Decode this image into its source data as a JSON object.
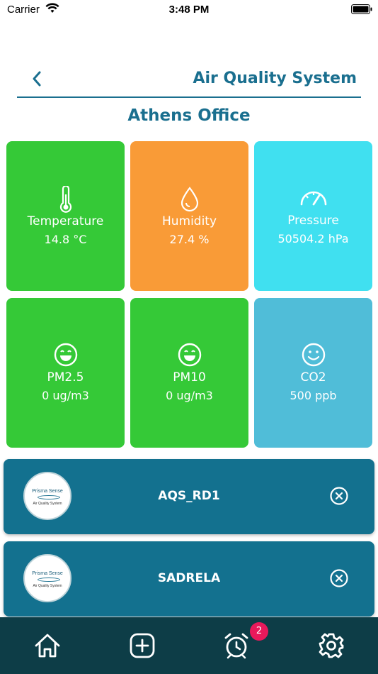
{
  "status_bar": {
    "carrier": "Carrier",
    "time": "3:48 PM"
  },
  "header": {
    "title": "Air Quality System",
    "back_icon": "chevron-left-icon"
  },
  "location": {
    "name": "Athens Office"
  },
  "tiles": [
    {
      "label": "Temperature",
      "value": "14.8 °C",
      "icon": "thermometer-icon",
      "color": "#35c937"
    },
    {
      "label": "Humidity",
      "value": "27.4 %",
      "icon": "droplet-icon",
      "color": "#f99b37"
    },
    {
      "label": "Pressure",
      "value": "50504.2 hPa",
      "icon": "gauge-icon",
      "color": "#40e0f0"
    },
    {
      "label": "PM2.5",
      "value": "0 ug/m3",
      "icon": "smiley-icon",
      "color": "#35c937"
    },
    {
      "label": "PM10",
      "value": "0 ug/m3",
      "icon": "smiley-icon",
      "color": "#35c937"
    },
    {
      "label": "CO2",
      "value": "500 ppb",
      "icon": "smiley-icon",
      "color": "#50bdd8"
    }
  ],
  "devices": [
    {
      "name": "AQS_RD1",
      "logo_brand": "Prisma Sense",
      "logo_sub": "Air Quality System"
    },
    {
      "name": "SADRELA",
      "logo_brand": "Prisma Sense",
      "logo_sub": "Air Quality System"
    }
  ],
  "nav": {
    "items": [
      "home-icon",
      "add-icon",
      "alarm-icon",
      "settings-icon"
    ],
    "alarm_badge": "2"
  },
  "colors": {
    "accent": "#1a6f8f",
    "card": "#13718f",
    "nav_bg": "#0d3d47",
    "badge": "#e8195b"
  }
}
